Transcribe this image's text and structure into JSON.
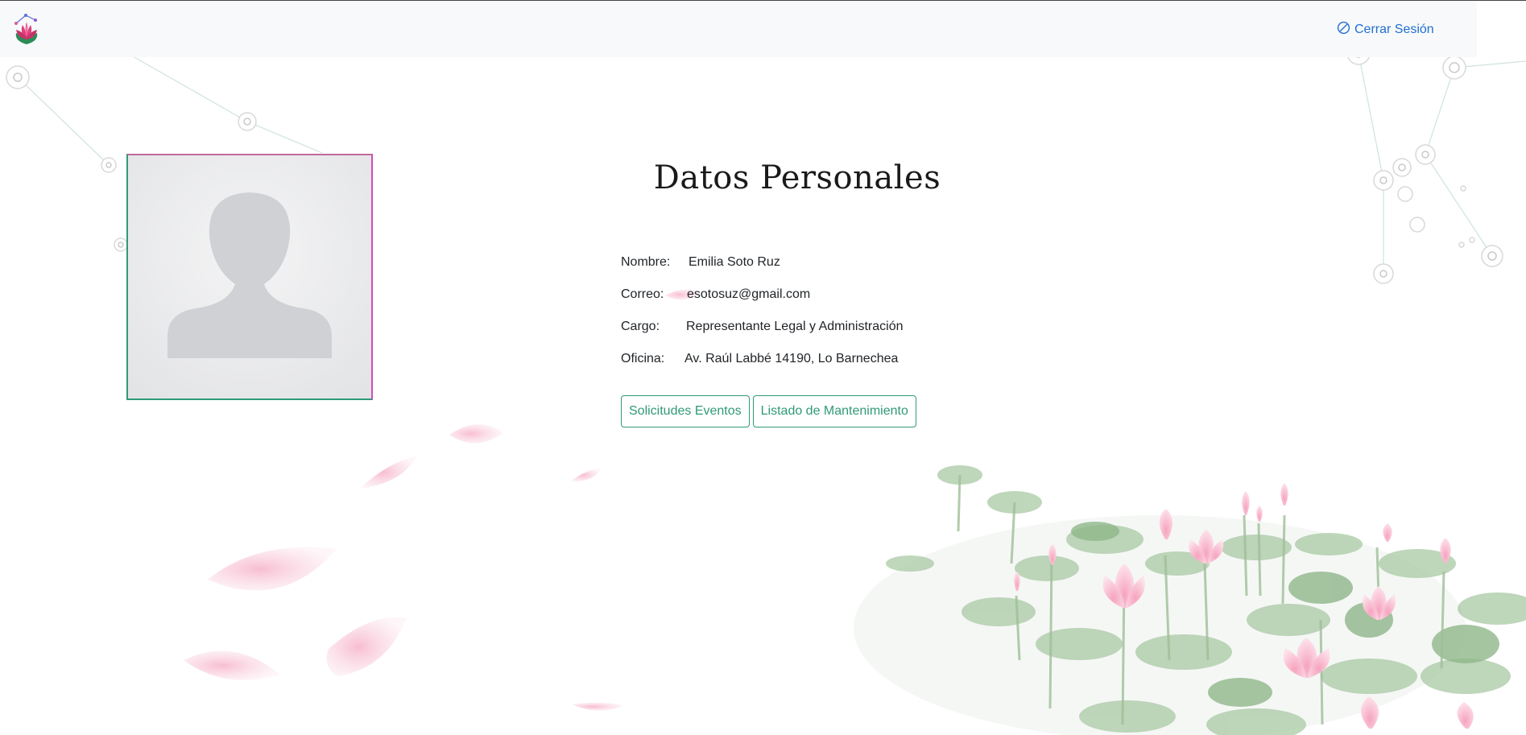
{
  "navbar": {
    "logo_icon": "lotus-logo-icon",
    "logout_icon": "circle-slash-icon",
    "logout_label": "Cerrar Sesión"
  },
  "profile": {
    "avatar_icon": "user-silhouette-icon",
    "title": "Datos Personales",
    "fields": [
      {
        "label": "Nombre:",
        "value": "Emilia Soto Ruz"
      },
      {
        "label": "Correo:",
        "value": "esotosuz@gmail.com"
      },
      {
        "label": "Cargo:",
        "value": "Representante Legal y Administración"
      },
      {
        "label": "Oficina:",
        "value": "Av. Raúl Labbé 14190, Lo Barnechea"
      }
    ]
  },
  "actions": {
    "solicitudes_label": "Solicitudes Eventos",
    "mantenimiento_label": "Listado de Mantenimiento"
  },
  "colors": {
    "accent_green": "#2f9a76",
    "link_blue": "#1f6fd1",
    "navbar_bg": "#f8f9fa",
    "petal_pink": "#f4a9c4",
    "leaf_green": "#a9c9a4"
  }
}
